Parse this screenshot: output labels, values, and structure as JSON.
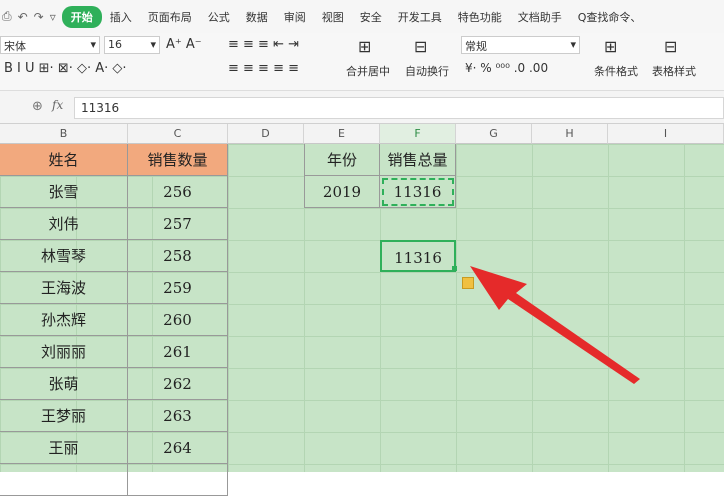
{
  "toolbar": {
    "tabs": [
      "开始",
      "插入",
      "页面布局",
      "公式",
      "数据",
      "审阅",
      "视图",
      "安全",
      "开发工具",
      "特色功能",
      "文档助手"
    ],
    "search": "Q查找命令、",
    "font": "宋体",
    "size": "16",
    "format": "常规",
    "merge": "合并居中",
    "wrap": "自动换行",
    "cond": "条件格式",
    "style": "表格样式"
  },
  "formula_bar": {
    "fx": "fx",
    "value": "11316"
  },
  "columns": [
    "B",
    "C",
    "D",
    "E",
    "F",
    "G",
    "H",
    "I"
  ],
  "table": {
    "headers": [
      "姓名",
      "销售数量"
    ],
    "rows": [
      [
        "张雪",
        "256"
      ],
      [
        "刘伟",
        "257"
      ],
      [
        "林雪琴",
        "258"
      ],
      [
        "王海波",
        "259"
      ],
      [
        "孙杰辉",
        "260"
      ],
      [
        "刘丽丽",
        "261"
      ],
      [
        "张萌",
        "262"
      ],
      [
        "王梦丽",
        "263"
      ],
      [
        "王丽",
        "264"
      ],
      [
        "",
        ""
      ]
    ]
  },
  "summary": {
    "year_label": "年份",
    "total_label": "销售总量",
    "year": "2019",
    "total": "11316"
  },
  "pasted": "11316",
  "colors": {
    "header": "#f2a97e",
    "selection": "#2fb05a",
    "arrow": "#e52a2a"
  }
}
